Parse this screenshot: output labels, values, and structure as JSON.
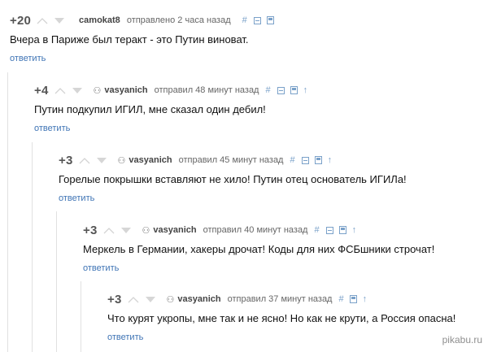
{
  "comments": [
    {
      "rating": "+20",
      "author": "camokat8",
      "sent": "отправлено 2 часа назад",
      "text": "Вчера в Париже был теракт - это Путин виноват.",
      "reply": "ответить"
    },
    {
      "rating": "+4",
      "author": "vasyanich",
      "sent": "отправил 48 минут назад",
      "text": "Путин подкупил ИГИЛ, мне сказал один дебил!",
      "reply": "ответить"
    },
    {
      "rating": "+3",
      "author": "vasyanich",
      "sent": "отправил 45 минут назад",
      "text": "Горелые покрышки вставляют не хило! Путин отец основатель ИГИЛа!",
      "reply": "ответить"
    },
    {
      "rating": "+3",
      "author": "vasyanich",
      "sent": "отправил 40 минут назад",
      "text": "Меркель в Германии, хакеры дрочат! Коды для них ФСБшники строчат!",
      "reply": "ответить"
    },
    {
      "rating": "+3",
      "author": "vasyanich",
      "sent": "отправил 37 минут назад",
      "text": "Что курят укропы, мне так и не ясно! Но как не крути, а Россия опасна!",
      "reply": "ответить"
    }
  ],
  "icons": {
    "vote_up": "vote-up-icon",
    "vote_down": "vote-down-icon",
    "hash": "#",
    "collapse": "collapse-icon",
    "save": "save-icon",
    "parent": "↑",
    "author": "user-icon"
  },
  "watermark": "pikabu.ru",
  "colors": {
    "link": "#3f74b5",
    "meta_icon": "#7aa1c9",
    "thread_line": "#e1e1e1"
  }
}
